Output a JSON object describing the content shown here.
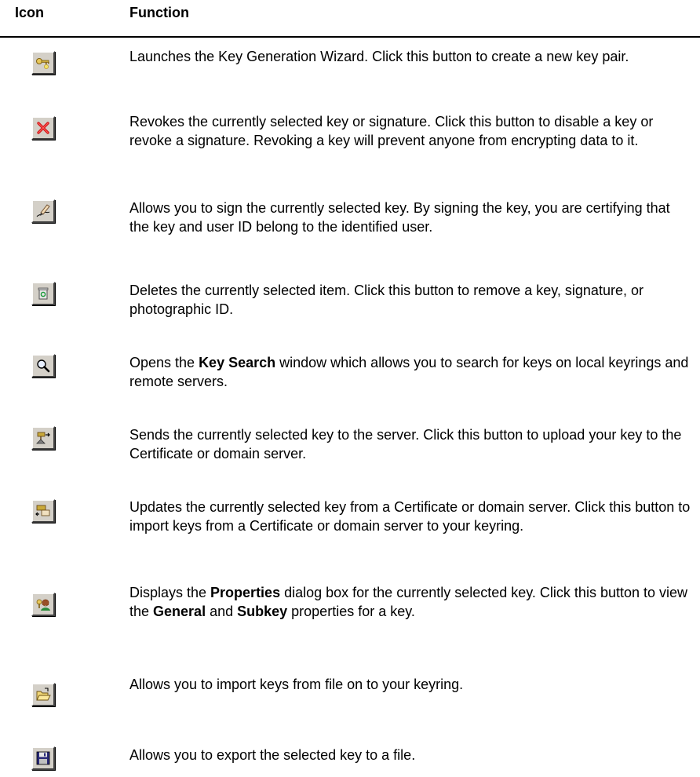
{
  "header": {
    "icon_label": "Icon",
    "function_label": "Function"
  },
  "rows": [
    {
      "icon": "new-key-icon",
      "text": "Launches the Key Generation Wizard. Click this button to create a new key pair."
    },
    {
      "icon": "revoke-icon",
      "text": "Revokes the currently selected key or signature. Click this button to disable a key or revoke a signature. Revoking a key will prevent anyone from encrypting data to it."
    },
    {
      "icon": "sign-icon",
      "text": "Allows you to sign the currently selected key. By signing the key, you are certifying that the key and user ID belong to the identified user."
    },
    {
      "icon": "delete-icon",
      "text": "Deletes the currently selected item. Click this button to remove a key, signature, or photographic ID."
    },
    {
      "icon": "search-icon",
      "text_before": "Opens the ",
      "bold": "Key Search",
      "text_after": " window which allows you to search for keys on local keyrings and remote servers."
    },
    {
      "icon": "send-to-server-icon",
      "text": "Sends the currently selected key to the server. Click this button to upload your key to the Certificate or domain server."
    },
    {
      "icon": "update-from-server-icon",
      "text": "Updates the currently selected key from a Certificate or domain server. Click this button to import keys from a Certificate or domain server to your keyring."
    },
    {
      "icon": "properties-icon",
      "text_before": "Displays the ",
      "bold": "Properties",
      "text_mid": " dialog box for the currently selected key. Click this button to view the ",
      "bold2": "General",
      "text_mid2": " and ",
      "bold3": "Subkey",
      "text_after": " properties for a key."
    },
    {
      "icon": "import-folder-icon",
      "text": "Allows you to import keys from file on to your keyring."
    },
    {
      "icon": "export-save-icon",
      "text": "Allows you to export the selected key to a file."
    }
  ]
}
